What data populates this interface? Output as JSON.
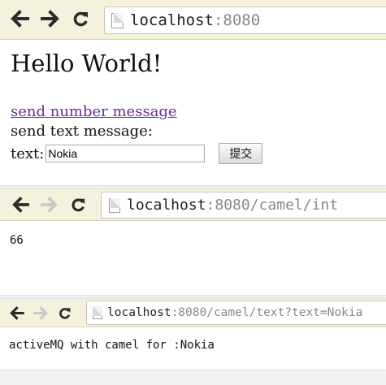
{
  "window1": {
    "url_host": "localhost",
    "url_path": ":8080",
    "heading": "Hello World!",
    "link_label": "send number message",
    "text_section_label": "send text message:",
    "field_label": "text:",
    "field_value": "Nokia",
    "submit_label": "提交"
  },
  "window2": {
    "url_host": "localhost",
    "url_path": ":8080/camel/int",
    "body_text": "66"
  },
  "window3": {
    "url_host": "localhost",
    "url_path": ":8080/camel/text?text=Nokia",
    "body_text": "activeMQ with camel for :Nokia"
  },
  "colors": {
    "toolbar_bg": "#f4f1dd",
    "link_color": "#6b2a9b",
    "disabled_arrow": "#c8c8c8",
    "icon_dark": "#2b2b2b"
  },
  "icons": [
    "back-arrow-icon",
    "forward-arrow-icon",
    "reload-icon",
    "page-icon"
  ]
}
